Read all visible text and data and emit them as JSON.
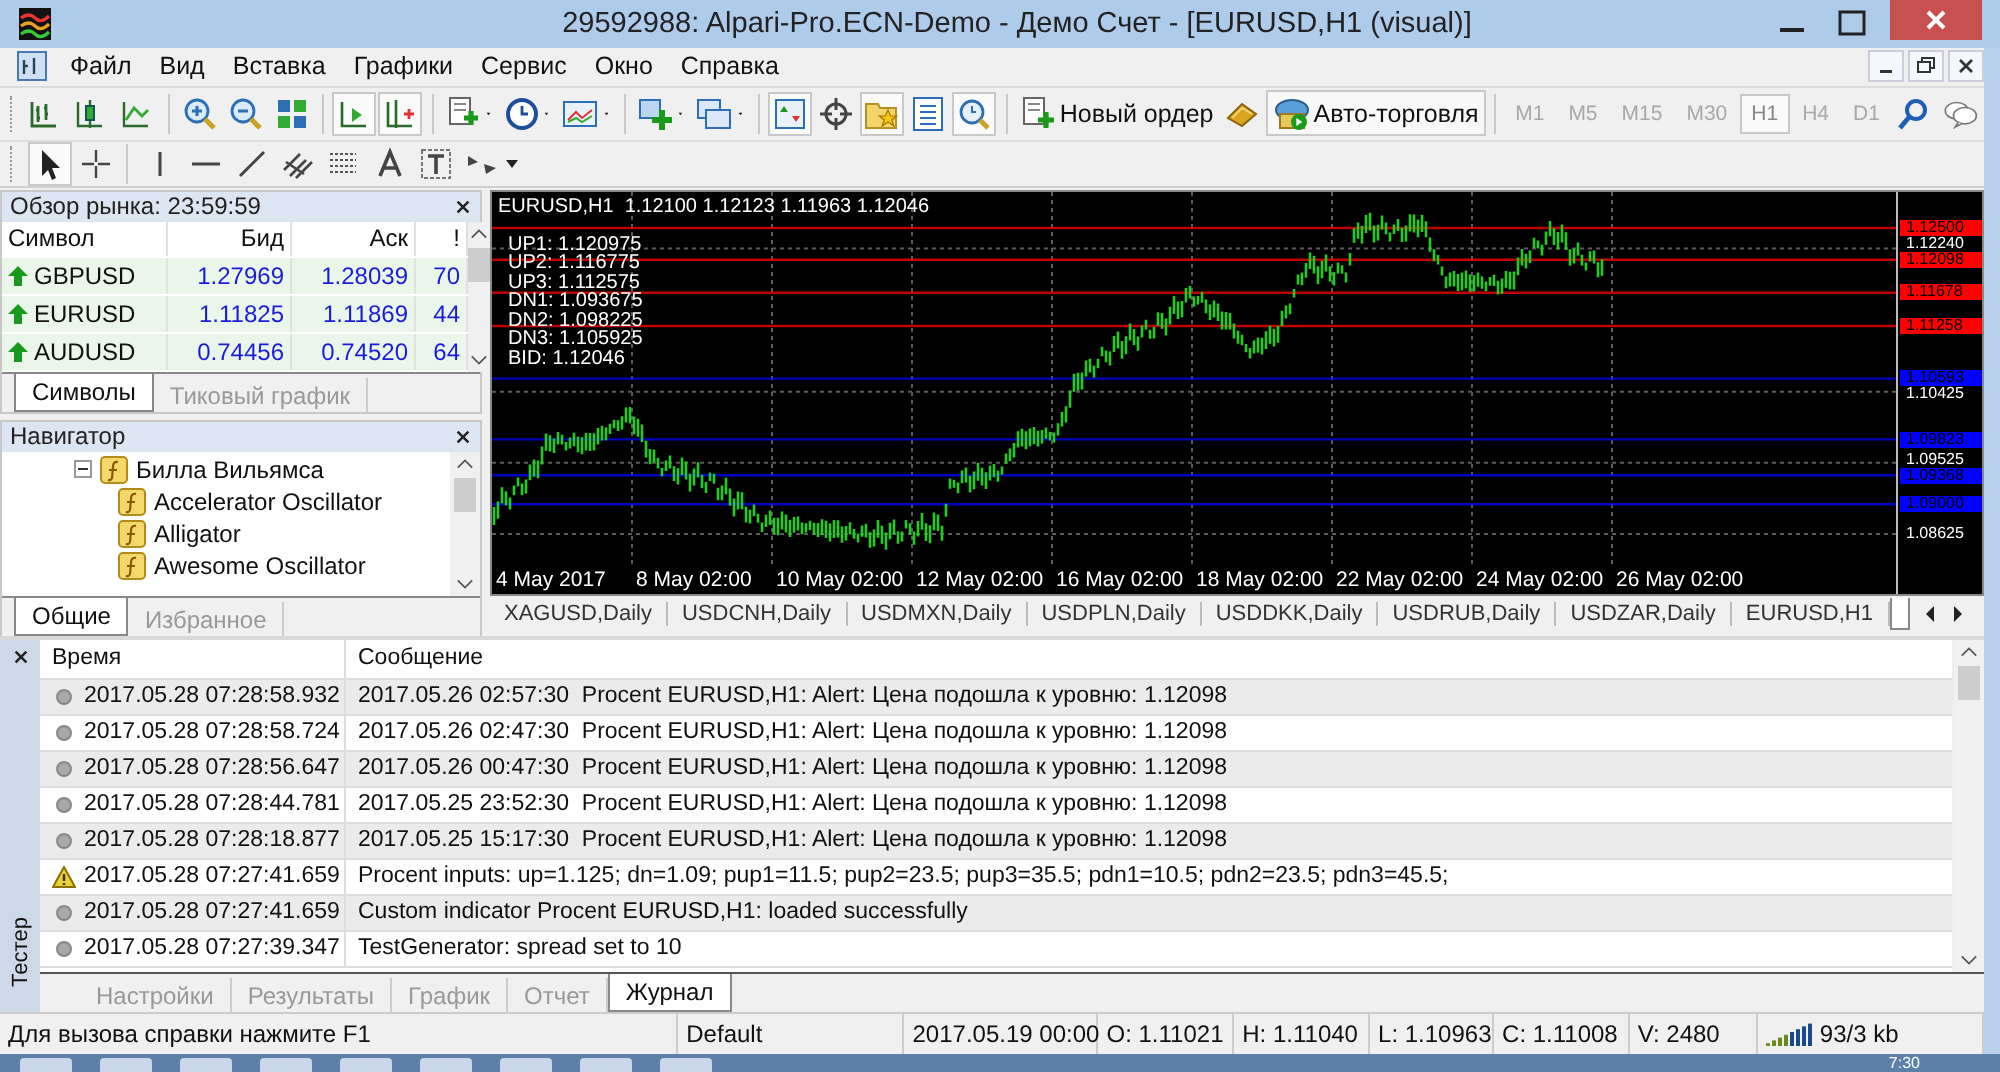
{
  "window": {
    "title": "29592988: Alpari-Pro.ECN-Demo - Демо Счет - [EURUSD,H1 (visual)]"
  },
  "menu": [
    "Файл",
    "Вид",
    "Вставка",
    "Графики",
    "Сервис",
    "Окно",
    "Справка"
  ],
  "toolbar": {
    "new_order": "Новый ордер",
    "auto_trading": "Авто-торговля"
  },
  "timeframes": [
    {
      "label": "M1",
      "selected": false
    },
    {
      "label": "M5",
      "selected": false
    },
    {
      "label": "M15",
      "selected": false
    },
    {
      "label": "M30",
      "selected": false
    },
    {
      "label": "H1",
      "selected": true
    },
    {
      "label": "H4",
      "selected": false
    },
    {
      "label": "D1",
      "selected": false
    }
  ],
  "market_watch": {
    "title": "Обзор рынка: 23:59:59",
    "columns": [
      "Символ",
      "Бид",
      "Аск",
      "!"
    ],
    "rows": [
      {
        "symbol": "GBPUSD",
        "bid": "1.27969",
        "ask": "1.28039",
        "spread": "70",
        "up": true
      },
      {
        "symbol": "EURUSD",
        "bid": "1.11825",
        "ask": "1.11869",
        "spread": "44",
        "up": true
      },
      {
        "symbol": "AUDUSD",
        "bid": "0.74456",
        "ask": "0.74520",
        "spread": "64",
        "up": true
      }
    ],
    "tabs": [
      {
        "label": "Символы",
        "selected": true
      },
      {
        "label": "Тиковый график",
        "selected": false
      }
    ]
  },
  "navigator": {
    "title": "Навигатор",
    "tree": [
      {
        "label": "Билла Вильямса",
        "expanded": true,
        "children": [
          {
            "label": "Accelerator Oscillator"
          },
          {
            "label": "Alligator"
          },
          {
            "label": "Awesome Oscillator"
          }
        ]
      }
    ],
    "tabs": [
      {
        "label": "Общие",
        "selected": true
      },
      {
        "label": "Избранное",
        "selected": false
      }
    ]
  },
  "chart": {
    "legend": "EURUSD,H1  1.12100 1.12123 1.11963 1.12046",
    "info_lines": [
      "UP1: 1.120975",
      "UP2: 1.116775",
      "UP3: 1.112575",
      "DN1: 1.093675",
      "DN2: 1.098225",
      "DN3: 1.105925",
      "BID: 1.12046"
    ],
    "levels": [
      {
        "price": "1.12500",
        "color": "#ff0000"
      },
      {
        "price": "1.12098",
        "color": "#ff0000"
      },
      {
        "price": "1.11678",
        "color": "#ff0000"
      },
      {
        "price": "1.11258",
        "color": "#ff0000"
      },
      {
        "price": "1.10593",
        "color": "#0000ff"
      },
      {
        "price": "1.09823",
        "color": "#0000ff"
      },
      {
        "price": "1.09368",
        "color": "#0000ff"
      },
      {
        "price": "1.09000",
        "color": "#0000ff"
      }
    ],
    "price_axis": [
      "1.12240",
      "1.10425",
      "1.09525",
      "1.08625"
    ],
    "time_axis": [
      "4 May 2017",
      "8 May 02:00",
      "10 May 02:00",
      "12 May 02:00",
      "16 May 02:00",
      "18 May 02:00",
      "22 May 02:00",
      "24 May 02:00",
      "26 May 02:00"
    ]
  },
  "chart_tabs": [
    {
      "label": "XAGUSD,Daily",
      "selected": false
    },
    {
      "label": "USDCNH,Daily",
      "selected": false
    },
    {
      "label": "USDMXN,Daily",
      "selected": false
    },
    {
      "label": "USDPLN,Daily",
      "selected": false
    },
    {
      "label": "USDDKK,Daily",
      "selected": false
    },
    {
      "label": "USDRUB,Daily",
      "selected": false
    },
    {
      "label": "USDZAR,Daily",
      "selected": false
    },
    {
      "label": "EURUSD,H1",
      "selected": false
    },
    {
      "selected": true
    }
  ],
  "tester": {
    "title": "Тестер",
    "columns": [
      "Время",
      "Сообщение"
    ],
    "rows": [
      {
        "kind": "info",
        "time": "2017.05.28 07:28:58.932",
        "message": "2017.05.26 02:57:30  Procent EURUSD,H1: Alert: Цена подошла к уровню: 1.12098"
      },
      {
        "kind": "info",
        "time": "2017.05.28 07:28:58.724",
        "message": "2017.05.26 02:47:30  Procent EURUSD,H1: Alert: Цена подошла к уровню: 1.12098"
      },
      {
        "kind": "info",
        "time": "2017.05.28 07:28:56.647",
        "message": "2017.05.26 00:47:30  Procent EURUSD,H1: Alert: Цена подошла к уровню: 1.12098"
      },
      {
        "kind": "info",
        "time": "2017.05.28 07:28:44.781",
        "message": "2017.05.25 23:52:30  Procent EURUSD,H1: Alert: Цена подошла к уровню: 1.12098"
      },
      {
        "kind": "info",
        "time": "2017.05.28 07:28:18.877",
        "message": "2017.05.25 15:17:30  Procent EURUSD,H1: Alert: Цена подошла к уровню: 1.12098"
      },
      {
        "kind": "warning",
        "time": "2017.05.28 07:27:41.659",
        "message": "Procent inputs: up=1.125; dn=1.09; pup1=11.5; pup2=23.5; pup3=35.5; pdn1=10.5; pdn2=23.5; pdn3=45.5;"
      },
      {
        "kind": "info",
        "time": "2017.05.28 07:27:41.659",
        "message": "Custom indicator Procent EURUSD,H1: loaded successfully"
      },
      {
        "kind": "info",
        "time": "2017.05.28 07:27:39.347",
        "message": "TestGenerator: spread set to 10"
      }
    ],
    "tabs": [
      {
        "label": "Настройки",
        "selected": false
      },
      {
        "label": "Результаты",
        "selected": false
      },
      {
        "label": "График",
        "selected": false
      },
      {
        "label": "Отчет",
        "selected": false
      },
      {
        "label": "Журнал",
        "selected": true
      }
    ]
  },
  "status_bar": [
    "Для вызова справки нажмите F1",
    "Default",
    "2017.05.19 00:00",
    "O: 1.11021",
    "H: 1.11040",
    "L: 1.10963",
    "C: 1.11008",
    "V: 2480",
    "93/3 kb"
  ],
  "taskbar": {
    "clock": "7:30"
  }
}
